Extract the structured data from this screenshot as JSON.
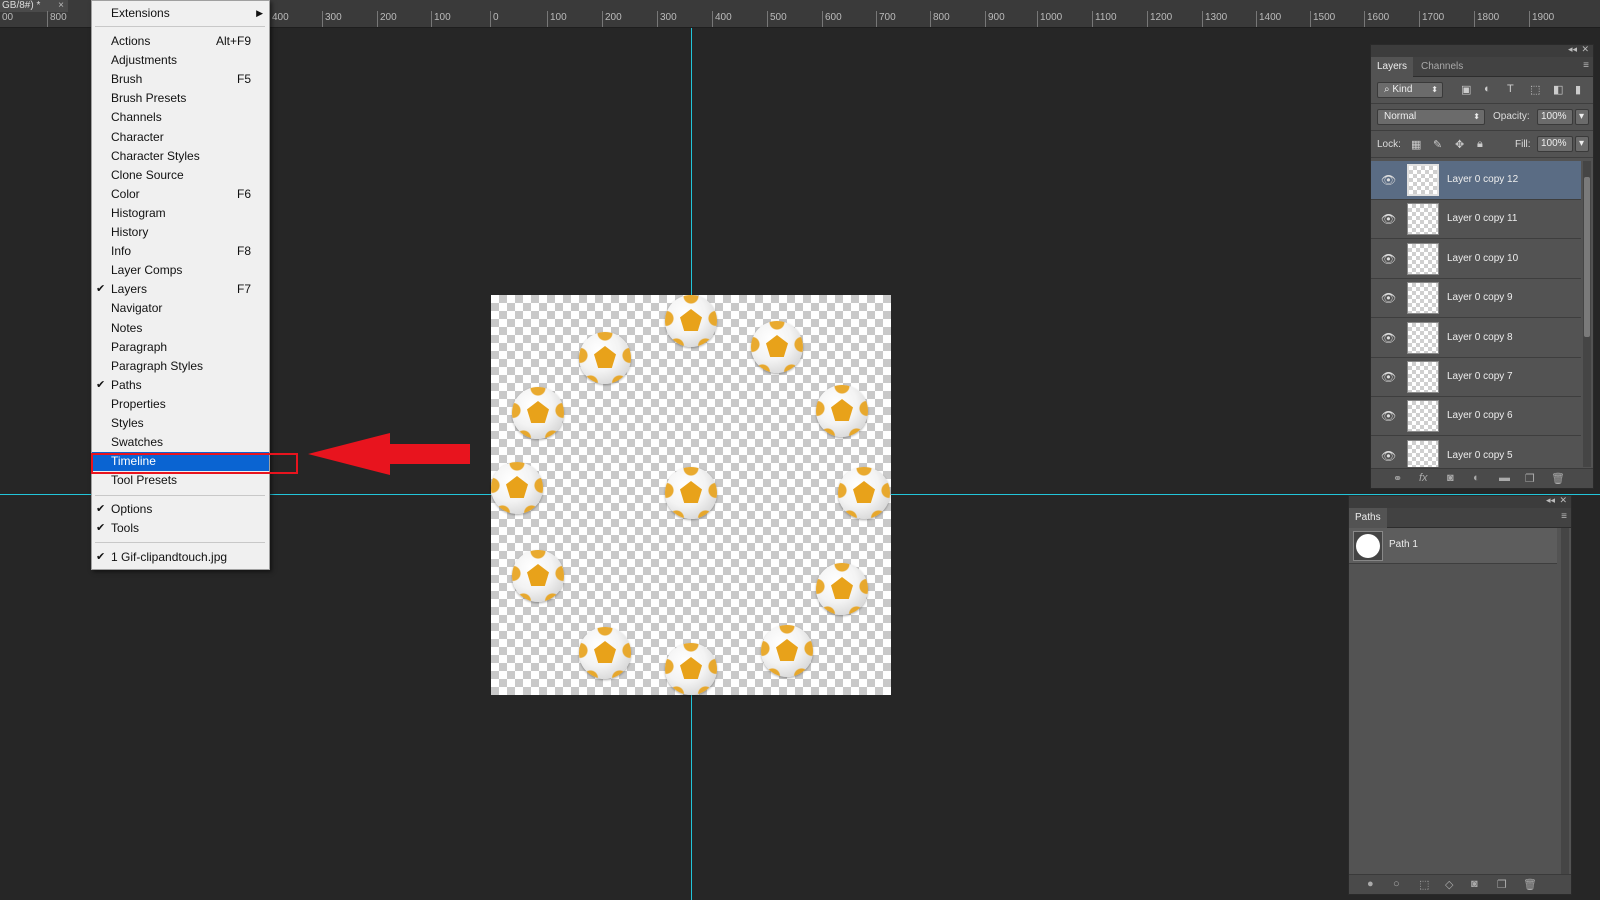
{
  "document": {
    "tab_title": "GB/8#) *",
    "close_glyph": "×"
  },
  "ruler": {
    "labels": [
      "00",
      "800",
      "400",
      "300",
      "200",
      "100",
      "0",
      "100",
      "200",
      "300",
      "400",
      "500",
      "600",
      "700",
      "800",
      "900",
      "1000",
      "1100",
      "1200",
      "1300",
      "1400",
      "1500",
      "1600",
      "1700",
      "1800",
      "1900"
    ]
  },
  "window_menu": {
    "extensions": "Extensions",
    "items": [
      {
        "label": "Actions",
        "shortcut": "Alt+F9",
        "checked": false
      },
      {
        "label": "Adjustments",
        "shortcut": "",
        "checked": false
      },
      {
        "label": "Brush",
        "shortcut": "F5",
        "checked": false
      },
      {
        "label": "Brush Presets",
        "shortcut": "",
        "checked": false
      },
      {
        "label": "Channels",
        "shortcut": "",
        "checked": false
      },
      {
        "label": "Character",
        "shortcut": "",
        "checked": false
      },
      {
        "label": "Character Styles",
        "shortcut": "",
        "checked": false
      },
      {
        "label": "Clone Source",
        "shortcut": "",
        "checked": false
      },
      {
        "label": "Color",
        "shortcut": "F6",
        "checked": false
      },
      {
        "label": "Histogram",
        "shortcut": "",
        "checked": false
      },
      {
        "label": "History",
        "shortcut": "",
        "checked": false
      },
      {
        "label": "Info",
        "shortcut": "F8",
        "checked": false
      },
      {
        "label": "Layer Comps",
        "shortcut": "",
        "checked": false
      },
      {
        "label": "Layers",
        "shortcut": "F7",
        "checked": true
      },
      {
        "label": "Navigator",
        "shortcut": "",
        "checked": false
      },
      {
        "label": "Notes",
        "shortcut": "",
        "checked": false
      },
      {
        "label": "Paragraph",
        "shortcut": "",
        "checked": false
      },
      {
        "label": "Paragraph Styles",
        "shortcut": "",
        "checked": false
      },
      {
        "label": "Paths",
        "shortcut": "",
        "checked": true
      },
      {
        "label": "Properties",
        "shortcut": "",
        "checked": false
      },
      {
        "label": "Styles",
        "shortcut": "",
        "checked": false
      },
      {
        "label": "Swatches",
        "shortcut": "",
        "checked": false
      },
      {
        "label": "Timeline",
        "shortcut": "",
        "checked": false,
        "selected": true
      },
      {
        "label": "Tool Presets",
        "shortcut": "",
        "checked": false
      }
    ],
    "options": "Options",
    "tools": "Tools",
    "file": "1 Gif-clipandtouch.jpg",
    "check_glyph": "✔",
    "submenu_glyph": "▶"
  },
  "layers_panel": {
    "tabs": [
      "Layers",
      "Channels"
    ],
    "kind_label": "Kind",
    "blend_mode": "Normal",
    "opacity_label": "Opacity:",
    "opacity_value": "100%",
    "lock_label": "Lock:",
    "fill_label": "Fill:",
    "fill_value": "100%",
    "layers": [
      {
        "name": "Layer 0 copy 12",
        "active": true
      },
      {
        "name": "Layer 0 copy 11",
        "active": false
      },
      {
        "name": "Layer 0 copy 10",
        "active": false
      },
      {
        "name": "Layer 0 copy 9",
        "active": false
      },
      {
        "name": "Layer 0 copy 8",
        "active": false
      },
      {
        "name": "Layer 0 copy 7",
        "active": false
      },
      {
        "name": "Layer 0 copy 6",
        "active": false
      },
      {
        "name": "Layer 0 copy 5",
        "active": false
      }
    ]
  },
  "paths_panel": {
    "tab": "Paths",
    "paths": [
      {
        "name": "Path 1"
      }
    ]
  },
  "colors": {
    "menu_selected": "#0a64d2",
    "guide": "#22c5d9",
    "annotation": "#e8141e",
    "ball_accent": "#e8a21a"
  }
}
